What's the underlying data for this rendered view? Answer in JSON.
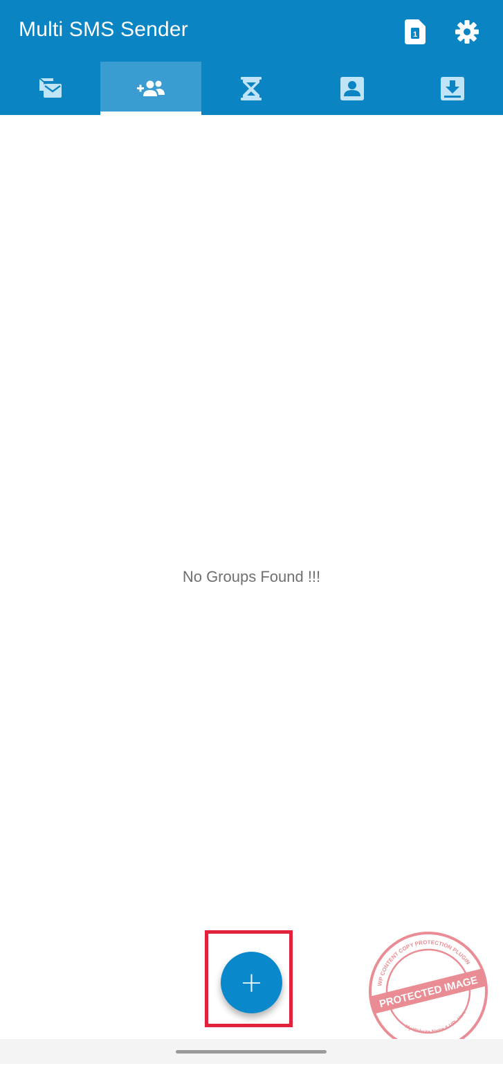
{
  "app": {
    "title": "Multi SMS Sender",
    "accent": "#0a84c2",
    "active_tab_bg": "#3a9cd1"
  },
  "header_actions": [
    {
      "icon": "sim-card-icon",
      "badge": "1"
    },
    {
      "icon": "gear-icon"
    }
  ],
  "tabs": [
    {
      "icon": "messages-icon",
      "active": false
    },
    {
      "icon": "add-group-icon",
      "active": true
    },
    {
      "icon": "hourglass-icon",
      "active": false
    },
    {
      "icon": "contact-icon",
      "active": false
    },
    {
      "icon": "download-icon",
      "active": false
    }
  ],
  "content": {
    "empty_message": "No Groups Found !!!"
  },
  "fab": {
    "label": "+",
    "highlight_color": "#e2213b"
  },
  "watermark": {
    "text": "PROTECTED IMAGE",
    "ring_top": "WP CONTENT COPY PROTECTION PLUGIN",
    "ring_bottom": "My Website Name & URL Here"
  }
}
